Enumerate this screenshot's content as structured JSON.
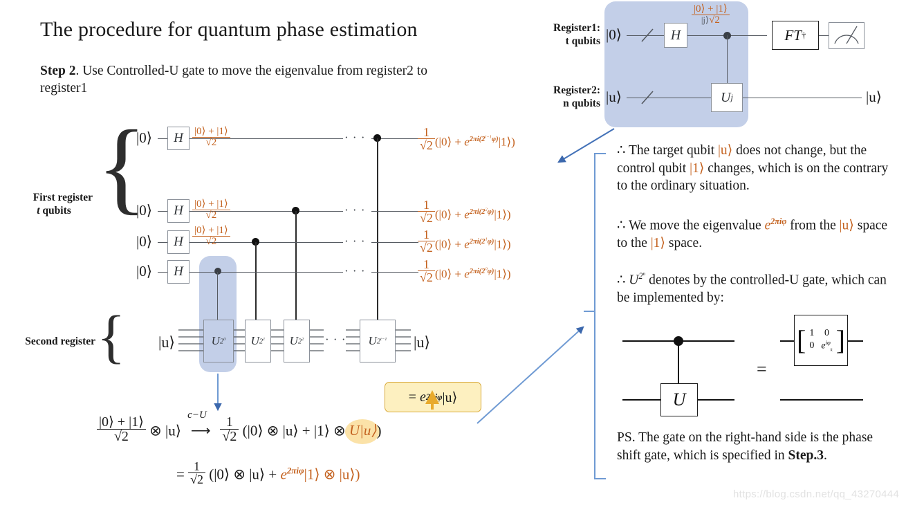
{
  "slide": {
    "title": "The procedure for quantum phase estimation",
    "step_label": "Step 2",
    "step_text": ". Use Controlled-U gate to move the eigenvalue from register2 to register1",
    "watermark": "https://blog.csdn.net/qq_43270444"
  },
  "colors": {
    "orange": "#c4621f",
    "blue_highlight": "#c3cfe8",
    "yellow_box_fill": "#fdf0c0",
    "yellow_box_border": "#d8a93a",
    "yellow_circle": "#fbe2a8",
    "arrow_blue": "#4472b8",
    "wire": "#555a61",
    "gate_border": "#8a9099"
  },
  "top_circuit": {
    "register1_label_line1": "Register1:",
    "register1_label_line2": "t qubits",
    "register2_label_line1": "Register2:",
    "register2_label_line2": "n qubits",
    "r1_input_ket": "|0⟩",
    "r2_input_ket": "|u⟩",
    "r2_output_ket": "|u⟩",
    "h_gate": "H",
    "state_numerator": "|0⟩ + |1⟩",
    "state_denominator": "√2",
    "state_prefix": "|j⟩",
    "u_gate_base": "U",
    "u_gate_exp": "j",
    "ft_gate": "FT",
    "ft_dagger": "†",
    "meter_icon": "meter-icon"
  },
  "main_circuit": {
    "first_register_label_line1": "First register",
    "first_register_label_line2_italic": "t",
    "first_register_label_line2_rest": " qubits",
    "second_register_label": "Second register",
    "input_ket_zero": "|0⟩",
    "input_ket_u": "|u⟩",
    "output_ket_u": "|u⟩",
    "h_gate": "H",
    "hadamard_state_num": "|0⟩ + |1⟩",
    "hadamard_state_den": "√2",
    "ellipsis": "· · ·",
    "u_gates": [
      {
        "base": "U",
        "exp": "2",
        "expexp": "0",
        "name": "u-gate-2-pow-0"
      },
      {
        "base": "U",
        "exp": "2",
        "expexp": "1",
        "name": "u-gate-2-pow-1"
      },
      {
        "base": "U",
        "exp": "2",
        "expexp": "2",
        "name": "u-gate-2-pow-2"
      },
      {
        "base": "U",
        "exp": "2",
        "expexp": "t−1",
        "name": "u-gate-2-pow-t-1"
      }
    ],
    "outputs": [
      {
        "frac_num": "1",
        "frac_den": "√2",
        "body_pre": "(|0⟩ + ",
        "exp_base": "e",
        "exp_text": "2πi(2",
        "exp_pow": "t−1",
        "exp_tail": "φ)",
        "body_post": "|1⟩)"
      },
      {
        "frac_num": "1",
        "frac_den": "√2",
        "body_pre": "(|0⟩ + ",
        "exp_base": "e",
        "exp_text": "2πi(2",
        "exp_pow": "2",
        "exp_tail": "φ)",
        "body_post": "|1⟩)"
      },
      {
        "frac_num": "1",
        "frac_den": "√2",
        "body_pre": "(|0⟩ + ",
        "exp_base": "e",
        "exp_text": "2πi(2",
        "exp_pow": "1",
        "exp_tail": "φ)",
        "body_post": "|1⟩)"
      },
      {
        "frac_num": "1",
        "frac_den": "√2",
        "body_pre": "(|0⟩ + ",
        "exp_base": "e",
        "exp_text": "2πi(2",
        "exp_pow": "0",
        "exp_tail": "φ)",
        "body_post": "|1⟩)"
      }
    ]
  },
  "bottom_equation": {
    "lhs_num": "|0⟩ + |1⟩",
    "lhs_den": "√2",
    "tensor": "⊗",
    "ket_u": "|u⟩",
    "arrow_label": "c−U",
    "arrow": "⟶",
    "frac_num": "1",
    "frac_den": "√2",
    "rhs_part1": "(|0⟩ ⊗ |u⟩ + |1⟩ ⊗ ",
    "rhs_highlight": "U|u⟩",
    "rhs_part2": ")",
    "line2_eq": "=",
    "line2_frac_num": "1",
    "line2_frac_den": "√2",
    "line2_pre": "(|0⟩ ⊗ |u⟩ + ",
    "line2_exp_base": "e",
    "line2_exp": "2πiφ",
    "line2_post": "|1⟩ ⊗ |u⟩)",
    "callout_eq": "=",
    "callout_exp_base": "e",
    "callout_exp": "2πiφ",
    "callout_ket": "|u⟩"
  },
  "notes": {
    "n1_sym": "∴",
    "n1_a": " The target qubit ",
    "n1_ket_u": "|u⟩",
    "n1_b": " does not change, but the control qubit ",
    "n1_ket_1": "|1⟩",
    "n1_c": " changes, which is on the contrary to the ordinary situation.",
    "n2_sym": "∴",
    "n2_a": " We move the eigenvalue ",
    "n2_exp_base": "e",
    "n2_exp": "2πiφ",
    "n2_b": " from the ",
    "n2_ket_u": "|u⟩",
    "n2_c": " space to the ",
    "n2_ket_1": "|1⟩",
    "n2_d": " space.",
    "n3_sym": "∴",
    "n3_u": "U",
    "n3_exp": "2",
    "n3_expexp": "n",
    "n3_a": " denotes by the controlled-U gate, which can be implemented by:",
    "ps_a": "PS. The gate on the right-hand side is the phase shift gate, which is specified in ",
    "ps_step": "Step.3",
    "ps_b": "."
  },
  "phase_gate": {
    "u_label": "U",
    "equals": "=",
    "matrix": [
      [
        "1",
        "0"
      ],
      [
        "0",
        "e^{iφk}"
      ]
    ],
    "m00": "1",
    "m01": "0",
    "m10": "0",
    "m11_base": "e",
    "m11_exp": "iφ",
    "m11_sub": "k"
  }
}
